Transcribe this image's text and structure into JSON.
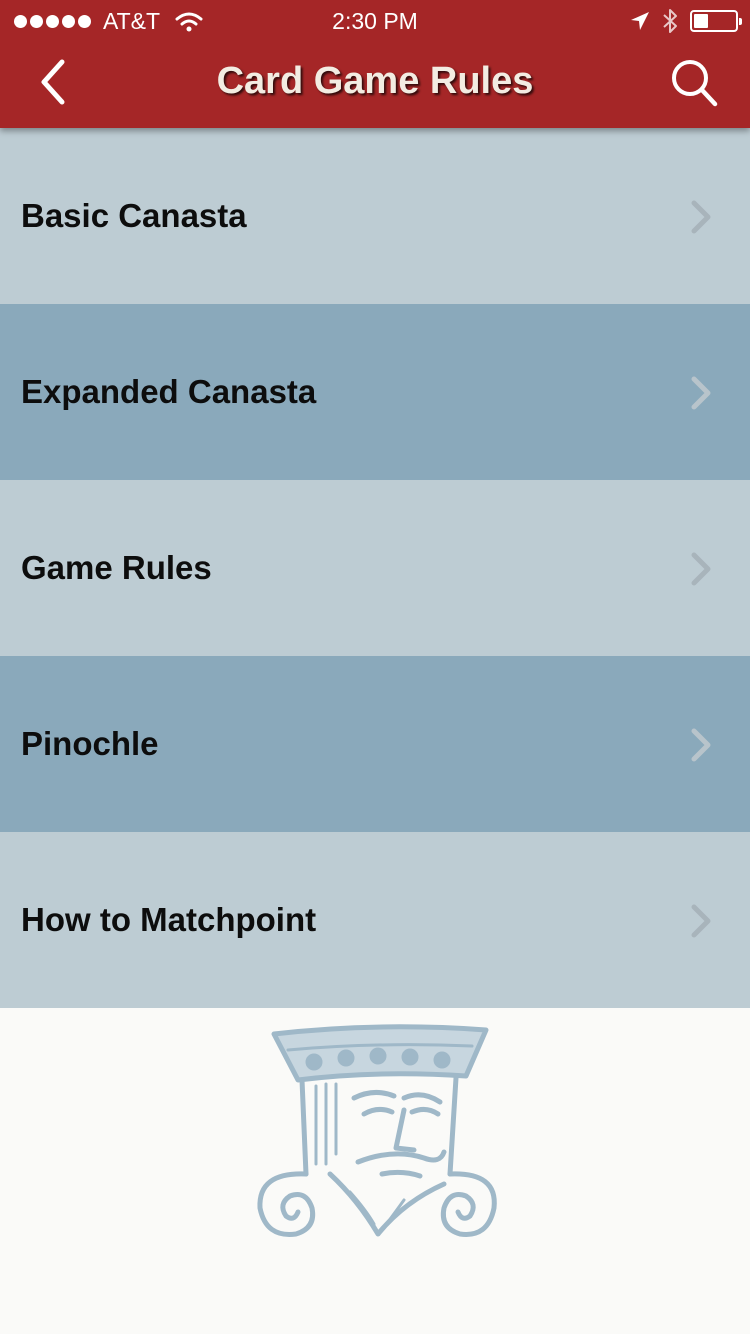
{
  "status_bar": {
    "carrier": "AT&T",
    "time": "2:30 PM",
    "battery_level": 0.35
  },
  "nav": {
    "title": "Card Game Rules",
    "back_icon": "chevron-left-icon",
    "search_icon": "search-icon"
  },
  "menu": {
    "items": [
      {
        "label": "Basic Canasta"
      },
      {
        "label": "Expanded Canasta"
      },
      {
        "label": "Game Rules"
      },
      {
        "label": "Pinochle"
      },
      {
        "label": "How to Matchpoint"
      }
    ],
    "chevron_icon": "chevron-right-icon"
  },
  "footer": {
    "logo_icon": "king-card-logo"
  },
  "colors": {
    "header": "#a52627",
    "row_light": "#bdccd3",
    "row_dark": "#8aa9bb",
    "logo": "#9fb8c8",
    "background": "#fafaf8"
  }
}
